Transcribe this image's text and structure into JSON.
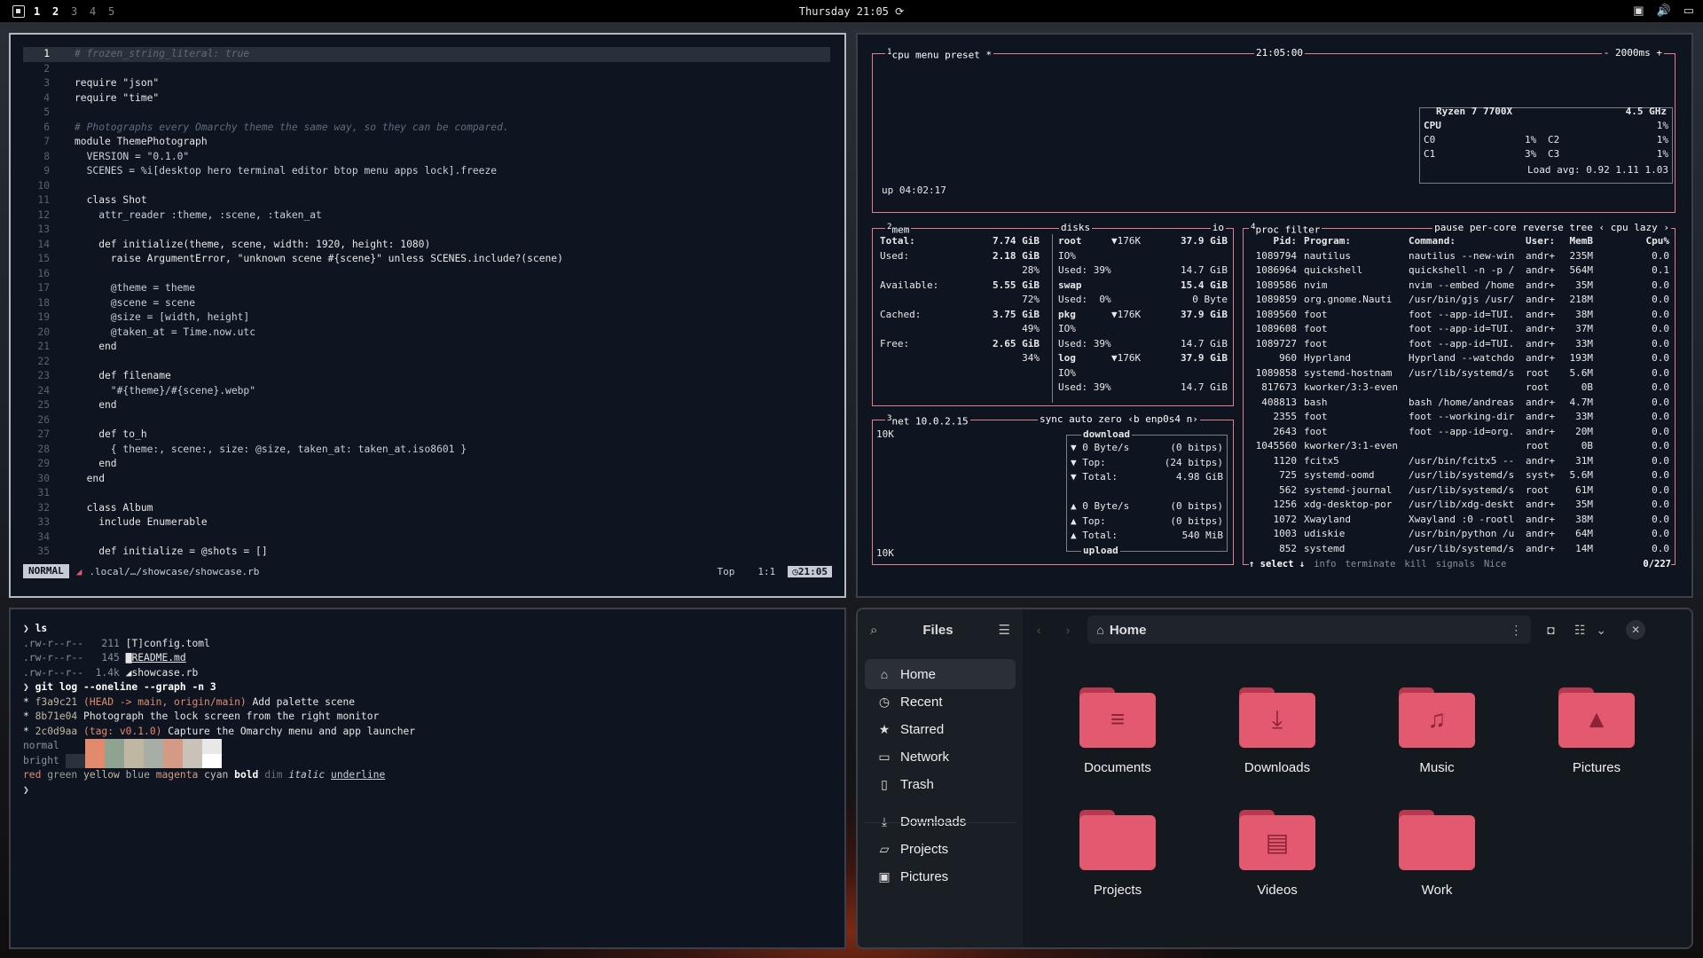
{
  "topbar": {
    "workspaces": [
      "1",
      "2",
      "3",
      "4",
      "5"
    ],
    "active_workspace": "1",
    "clock": "Thursday 21:05"
  },
  "editor": {
    "lines": [
      {
        "n": "1",
        "t": "# frozen_string_literal: true"
      },
      {
        "n": "2",
        "t": ""
      },
      {
        "n": "3",
        "t": "require \"json\""
      },
      {
        "n": "4",
        "t": "require \"time\""
      },
      {
        "n": "5",
        "t": ""
      },
      {
        "n": "6",
        "t": "# Photographs every Omarchy theme the same way, so they can be compared."
      },
      {
        "n": "7",
        "t": "module ThemePhotograph"
      },
      {
        "n": "8",
        "t": "  VERSION = \"0.1.0\""
      },
      {
        "n": "9",
        "t": "  SCENES = %i[desktop hero terminal editor btop menu apps lock].freeze"
      },
      {
        "n": "10",
        "t": ""
      },
      {
        "n": "11",
        "t": "  class Shot"
      },
      {
        "n": "12",
        "t": "    attr_reader :theme, :scene, :taken_at"
      },
      {
        "n": "13",
        "t": ""
      },
      {
        "n": "14",
        "t": "    def initialize(theme, scene, width: 1920, height: 1080)"
      },
      {
        "n": "15",
        "t": "      raise ArgumentError, \"unknown scene #{scene}\" unless SCENES.include?(scene)"
      },
      {
        "n": "16",
        "t": ""
      },
      {
        "n": "17",
        "t": "      @theme = theme"
      },
      {
        "n": "18",
        "t": "      @scene = scene"
      },
      {
        "n": "19",
        "t": "      @size = [width, height]"
      },
      {
        "n": "20",
        "t": "      @taken_at = Time.now.utc"
      },
      {
        "n": "21",
        "t": "    end"
      },
      {
        "n": "22",
        "t": ""
      },
      {
        "n": "23",
        "t": "    def filename"
      },
      {
        "n": "24",
        "t": "      \"#{theme}/#{scene}.webp\""
      },
      {
        "n": "25",
        "t": "    end"
      },
      {
        "n": "26",
        "t": ""
      },
      {
        "n": "27",
        "t": "    def to_h"
      },
      {
        "n": "28",
        "t": "      { theme:, scene:, size: @size, taken_at: taken_at.iso8601 }"
      },
      {
        "n": "29",
        "t": "    end"
      },
      {
        "n": "30",
        "t": "  end"
      },
      {
        "n": "31",
        "t": ""
      },
      {
        "n": "32",
        "t": "  class Album"
      },
      {
        "n": "33",
        "t": "    include Enumerable"
      },
      {
        "n": "34",
        "t": ""
      },
      {
        "n": "35",
        "t": "    def initialize = @shots = []"
      }
    ],
    "status": {
      "mode": "NORMAL",
      "path": ".local/…/showcase/showcase.rb",
      "scroll": "Top",
      "position": "1:1",
      "time": "21:05"
    }
  },
  "btop": {
    "cpu": {
      "label_num": "1",
      "label": "cpu",
      "menu": "menu",
      "preset": "preset *",
      "time": "21:05:00",
      "interval": "- 2000ms +",
      "model": "Ryzen 7 7700X",
      "freq": "4.5 GHz",
      "rows": [
        {
          "name": "CPU",
          "val": "1%"
        },
        {
          "name": "C0",
          "val": "1%",
          "name2": "C2",
          "val2": "1%"
        },
        {
          "name": "C1",
          "val": "3%",
          "name2": "C3",
          "val2": "1%"
        }
      ],
      "load": "Load avg: 0.92 1.11 1.03",
      "uptime": "up 04:02:17"
    },
    "mem": {
      "label_num": "2",
      "label": "mem",
      "rows": [
        {
          "k": "Total:",
          "v": "7.74 GiB"
        },
        {
          "k": "Used:",
          "v": "2.18 GiB",
          "p": "28%"
        },
        {
          "k": "Available:",
          "v": "5.55 GiB",
          "p": "72%"
        },
        {
          "k": "Cached:",
          "v": "3.75 GiB",
          "p": "49%"
        },
        {
          "k": "Free:",
          "v": "2.65 GiB",
          "p": "34%"
        }
      ]
    },
    "disks": {
      "label": "disks",
      "io": "io",
      "rows": [
        {
          "name": "root",
          "speed": "▼176K",
          "size": "37.9 GiB",
          "io": "IO%",
          "used": "Used: 39%",
          "free": "14.7 GiB"
        },
        {
          "name": "swap",
          "speed": "",
          "size": "15.4 GiB",
          "io": "",
          "used": "Used:  0%",
          "free": "0 Byte"
        },
        {
          "name": "pkg",
          "speed": "▼176K",
          "size": "37.9 GiB",
          "io": "IO%",
          "used": "Used: 39%",
          "free": "14.7 GiB"
        },
        {
          "name": "log",
          "speed": "▼176K",
          "size": "37.9 GiB",
          "io": "IO%",
          "used": "Used: 39%",
          "free": "14.7 GiB"
        }
      ]
    },
    "net": {
      "label_num": "3",
      "label": "net",
      "ip": "10.0.2.15",
      "opts": "sync",
      "auto": "auto",
      "zero": "zero",
      "iface": "‹b enp0s4 n›",
      "scale_top": "10K",
      "scale_bottom": "10K",
      "download_label": "download",
      "upload_label": "upload",
      "down": [
        {
          "k": "▼ 0 Byte/s",
          "v": "(0 bitps)"
        },
        {
          "k": "▼ Top:",
          "v": "(24 bitps)"
        },
        {
          "k": "▼ Total:",
          "v": "4.98 GiB"
        }
      ],
      "up": [
        {
          "k": "▲ 0 Byte/s",
          "v": "(0 bitps)"
        },
        {
          "k": "▲ Top:",
          "v": "(0 bitps)"
        },
        {
          "k": "▲ Total:",
          "v": "540 MiB"
        }
      ]
    },
    "proc": {
      "label_num": "4",
      "label": "proc",
      "filter": "filter",
      "opts": "pause per-core reverse tree ‹ cpu lazy ›",
      "headers": {
        "pid": "Pid:",
        "prog": "Program:",
        "cmd": "Command:",
        "user": "User:",
        "mem": "MemB",
        "cpu": "Cpu%"
      },
      "rows": [
        {
          "pid": "1089794",
          "prog": "nautilus",
          "cmd": "nautilus --new-win",
          "user": "andr+",
          "mem": "235M",
          "cpu": "0.0"
        },
        {
          "pid": "1086964",
          "prog": "quickshell",
          "cmd": "quickshell -n -p /",
          "user": "andr+",
          "mem": "564M",
          "cpu": "0.1"
        },
        {
          "pid": "1089586",
          "prog": "nvim",
          "cmd": "nvim --embed /home",
          "user": "andr+",
          "mem": "35M",
          "cpu": "0.0"
        },
        {
          "pid": "1089859",
          "prog": "org.gnome.Nauti",
          "cmd": "/usr/bin/gjs /usr/",
          "user": "andr+",
          "mem": "218M",
          "cpu": "0.0"
        },
        {
          "pid": "1089560",
          "prog": "foot",
          "cmd": "foot --app-id=TUI.",
          "user": "andr+",
          "mem": "38M",
          "cpu": "0.0"
        },
        {
          "pid": "1089608",
          "prog": "foot",
          "cmd": "foot --app-id=TUI.",
          "user": "andr+",
          "mem": "37M",
          "cpu": "0.0"
        },
        {
          "pid": "1089727",
          "prog": "foot",
          "cmd": "foot --app-id=TUI.",
          "user": "andr+",
          "mem": "33M",
          "cpu": "0.0"
        },
        {
          "pid": "960",
          "prog": "Hyprland",
          "cmd": "Hyprland --watchdo",
          "user": "andr+",
          "mem": "193M",
          "cpu": "0.0"
        },
        {
          "pid": "1089858",
          "prog": "systemd-hostnam",
          "cmd": "/usr/lib/systemd/s",
          "user": "root",
          "mem": "5.6M",
          "cpu": "0.0"
        },
        {
          "pid": "817673",
          "prog": "kworker/3:3-even",
          "cmd": "",
          "user": "root",
          "mem": "0B",
          "cpu": "0.0"
        },
        {
          "pid": "408813",
          "prog": "bash",
          "cmd": "bash /home/andreas",
          "user": "andr+",
          "mem": "4.7M",
          "cpu": "0.0"
        },
        {
          "pid": "2355",
          "prog": "foot",
          "cmd": "foot --working-dir",
          "user": "andr+",
          "mem": "33M",
          "cpu": "0.0"
        },
        {
          "pid": "2643",
          "prog": "foot",
          "cmd": "foot --app-id=org.",
          "user": "andr+",
          "mem": "20M",
          "cpu": "0.0"
        },
        {
          "pid": "1045560",
          "prog": "kworker/3:1-even",
          "cmd": "",
          "user": "root",
          "mem": "0B",
          "cpu": "0.0"
        },
        {
          "pid": "1120",
          "prog": "fcitx5",
          "cmd": "/usr/bin/fcitx5 --",
          "user": "andr+",
          "mem": "31M",
          "cpu": "0.0"
        },
        {
          "pid": "725",
          "prog": "systemd-oomd",
          "cmd": "/usr/lib/systemd/s",
          "user": "syst+",
          "mem": "5.6M",
          "cpu": "0.0"
        },
        {
          "pid": "562",
          "prog": "systemd-journal",
          "cmd": "/usr/lib/systemd/s",
          "user": "root",
          "mem": "61M",
          "cpu": "0.0"
        },
        {
          "pid": "1256",
          "prog": "xdg-desktop-por",
          "cmd": "/usr/lib/xdg-deskt",
          "user": "andr+",
          "mem": "35M",
          "cpu": "0.0"
        },
        {
          "pid": "1072",
          "prog": "Xwayland",
          "cmd": "Xwayland :0 -rootl",
          "user": "andr+",
          "mem": "38M",
          "cpu": "0.0"
        },
        {
          "pid": "1003",
          "prog": "udiskie",
          "cmd": "/usr/bin/python /u",
          "user": "andr+",
          "mem": "64M",
          "cpu": "0.0"
        },
        {
          "pid": "852",
          "prog": "systemd",
          "cmd": "/usr/lib/systemd/s",
          "user": "andr+",
          "mem": "14M",
          "cpu": "0.0"
        }
      ],
      "footer": {
        "select": "↑ select ↓",
        "info": "info",
        "terminate": "terminate",
        "kill": "kill",
        "signals": "signals",
        "nice": "Nice",
        "count": "0/227"
      }
    }
  },
  "terminal": {
    "lines": [
      {
        "type": "prompt",
        "text": "ls"
      },
      {
        "type": "file",
        "perm": ".rw-r--r--",
        "size": "211",
        "icon": "[T]",
        "name": "config.toml"
      },
      {
        "type": "file",
        "perm": ".rw-r--r--",
        "size": "145",
        "icon": "▇",
        "name": "README.md"
      },
      {
        "type": "file",
        "perm": ".rw-r--r--",
        "size": "1.4k",
        "icon": "◢",
        "name": "showcase.rb"
      },
      {
        "type": "prompt",
        "text": "git log --oneline --graph -n 3"
      },
      {
        "type": "git",
        "hash": "f3a9c21",
        "ref": "(HEAD -> main, origin/main)",
        "msg": "Add palette scene"
      },
      {
        "type": "git",
        "hash": "8b71e04",
        "ref": "",
        "msg": "Photograph the lock screen from the right monitor"
      },
      {
        "type": "git",
        "hash": "2c0d9aa",
        "ref": "(tag: v0.1.0)",
        "msg": "Capture the Omarchy menu and app launcher"
      }
    ],
    "palette_normal": "normal",
    "palette_bright": "bright",
    "normal_colors": [
      "#0e1520",
      "#e38a6e",
      "#8fa390",
      "#c0b7a3",
      "#a8ada6",
      "#d49a86",
      "#c9c2b9",
      "#e8e8e8"
    ],
    "bright_colors": [
      "#2a323e",
      "#e38a6e",
      "#8fa390",
      "#c0b7a3",
      "#a8ada6",
      "#d49a86",
      "#c9c2b9",
      "#ffffff"
    ],
    "styles": [
      "red",
      "green",
      "yellow",
      "blue",
      "magenta",
      "cyan",
      "bold",
      "dim",
      "italic",
      "underline"
    ],
    "final_prompt": "❯"
  },
  "files": {
    "title": "Files",
    "location": "Home",
    "sidebar": [
      {
        "icon": "home-icon",
        "glyph": "⌂",
        "label": "Home"
      },
      {
        "icon": "recent-icon",
        "glyph": "◷",
        "label": "Recent"
      },
      {
        "icon": "star-icon",
        "glyph": "★",
        "label": "Starred"
      },
      {
        "icon": "network-icon",
        "glyph": "▭",
        "label": "Network"
      },
      {
        "icon": "trash-icon",
        "glyph": "▯",
        "label": "Trash"
      },
      {
        "icon": "download-icon",
        "glyph": "⤓",
        "label": "Downloads"
      },
      {
        "icon": "folder-icon",
        "glyph": "▱",
        "label": "Projects"
      },
      {
        "icon": "image-icon",
        "glyph": "▣",
        "label": "Pictures"
      }
    ],
    "folders": [
      {
        "label": "Documents",
        "glyph": "≡"
      },
      {
        "label": "Downloads",
        "glyph": "⤓"
      },
      {
        "label": "Music",
        "glyph": "♫"
      },
      {
        "label": "Pictures",
        "glyph": "▲"
      },
      {
        "label": "Projects",
        "glyph": ""
      },
      {
        "label": "Videos",
        "glyph": "▤"
      },
      {
        "label": "Work",
        "glyph": ""
      }
    ],
    "accent": "#e35a70"
  }
}
